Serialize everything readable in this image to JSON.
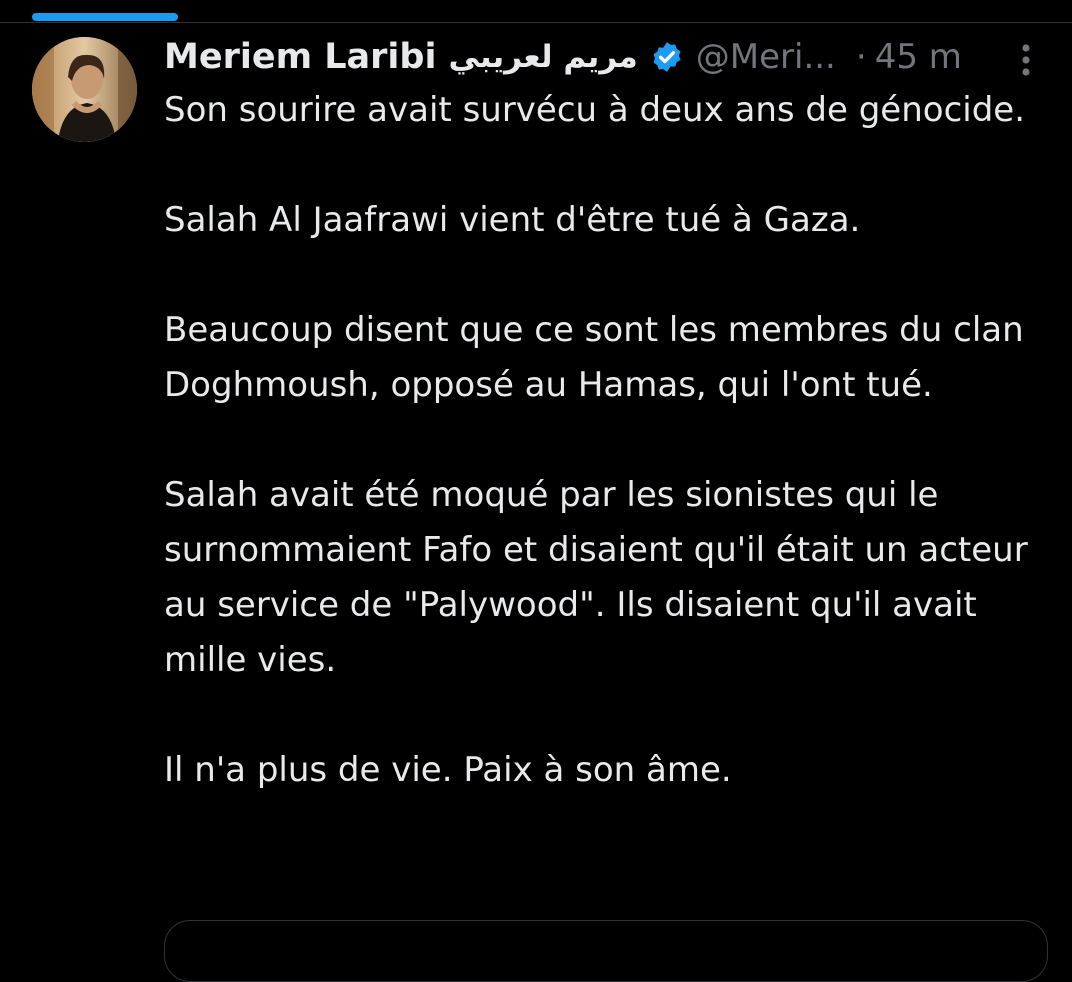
{
  "colors": {
    "background": "#000000",
    "text_primary": "#e7e9ea",
    "text_secondary": "#71767b",
    "accent": "#1d9bf0",
    "divider": "#2f3336"
  },
  "tweet": {
    "author": {
      "display_name": "Meriem Laribi",
      "display_name_ar": "مريم لعريبي",
      "handle": "@Meri...",
      "verified_icon": "verified-badge-icon",
      "avatar_icon": "avatar"
    },
    "separator": "·",
    "timestamp": "45 m",
    "more_icon": "more-vertical-icon",
    "paragraphs": [
      "Son sourire avait survécu à deux ans de génocide.",
      "Salah Al Jaafrawi vient d'être tué à Gaza.",
      "Beaucoup disent que ce sont les membres du clan Doghmoush, opposé au Hamas, qui l'ont tué.",
      "Salah avait été moqué par les sionistes qui le surnommaient Fafo et disaient qu'il était un acteur au service de \"Palywood\". Ils disaient qu'il avait mille vies.",
      "Il n'a plus de vie. Paix à son âme."
    ]
  }
}
